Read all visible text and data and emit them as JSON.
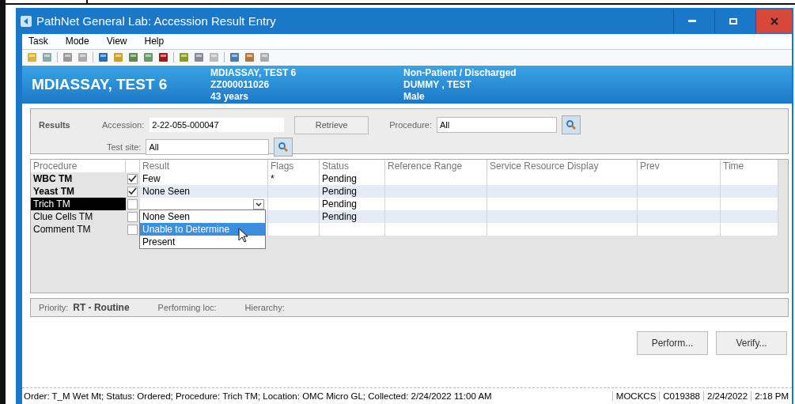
{
  "window": {
    "title": "PathNet General Lab: Accession Result Entry"
  },
  "menu": [
    "Task",
    "Mode",
    "View",
    "Help"
  ],
  "patient": {
    "name": "MDIASSAY, TEST 6",
    "details_left": [
      "MDIASSAY, TEST 6",
      "ZZ000011026",
      "43 years"
    ],
    "details_right": [
      "Non-Patient / Discharged",
      "DUMMY , TEST",
      "Male"
    ]
  },
  "results": {
    "title": "Results",
    "accession_label": "Accession:",
    "accession": "2-22-055-000047",
    "retrieve": "Retrieve",
    "procedure_label": "Procedure:",
    "procedure": "All",
    "test_site_label": "Test site:",
    "test_site": "All"
  },
  "table": {
    "columns": [
      "Procedure",
      "Result",
      "Flags",
      "Status",
      "Reference Range",
      "Service Resource Display",
      "Prev",
      "Time"
    ],
    "rows": [
      {
        "procedure": "WBC TM",
        "checked": true,
        "result": "Few",
        "kind": "text",
        "flags": "*",
        "status": "Pending",
        "selected": false
      },
      {
        "procedure": "Yeast TM",
        "checked": true,
        "result": "None Seen",
        "kind": "text",
        "flags": "",
        "status": "Pending",
        "selected": false
      },
      {
        "procedure": "Trich TM",
        "checked": false,
        "result": "",
        "kind": "combo",
        "flags": "",
        "status": "Pending",
        "selected": true
      },
      {
        "procedure": "Clue Cells TM",
        "checked": false,
        "result": "",
        "kind": "text",
        "flags": "",
        "status": "Pending",
        "selected": false
      },
      {
        "procedure": "Comment TM",
        "checked": false,
        "result": "",
        "kind": "text",
        "flags": "",
        "status": "",
        "selected": false
      }
    ],
    "dropdown": [
      {
        "label": "None Seen",
        "selected": false
      },
      {
        "label": "Unable to Determine",
        "selected": true
      },
      {
        "label": "Present",
        "selected": false
      }
    ]
  },
  "info": {
    "priority_label": "Priority:",
    "priority": "RT - Routine",
    "performing_label": "Performing loc:",
    "hierarchy_label": "Hierarchy:"
  },
  "buttons": [
    "Perform...",
    "Verify..."
  ],
  "status_bar": {
    "message": "Order: T_M Wet Mt; Status: Ordered; Procedure: Trich TM; Location: OMC Micro GL; Collected: 2/24/2022 11:00 AM",
    "panes": [
      "MOCKCS",
      "C019388",
      "2/24/2022",
      "2:18 PM"
    ]
  }
}
